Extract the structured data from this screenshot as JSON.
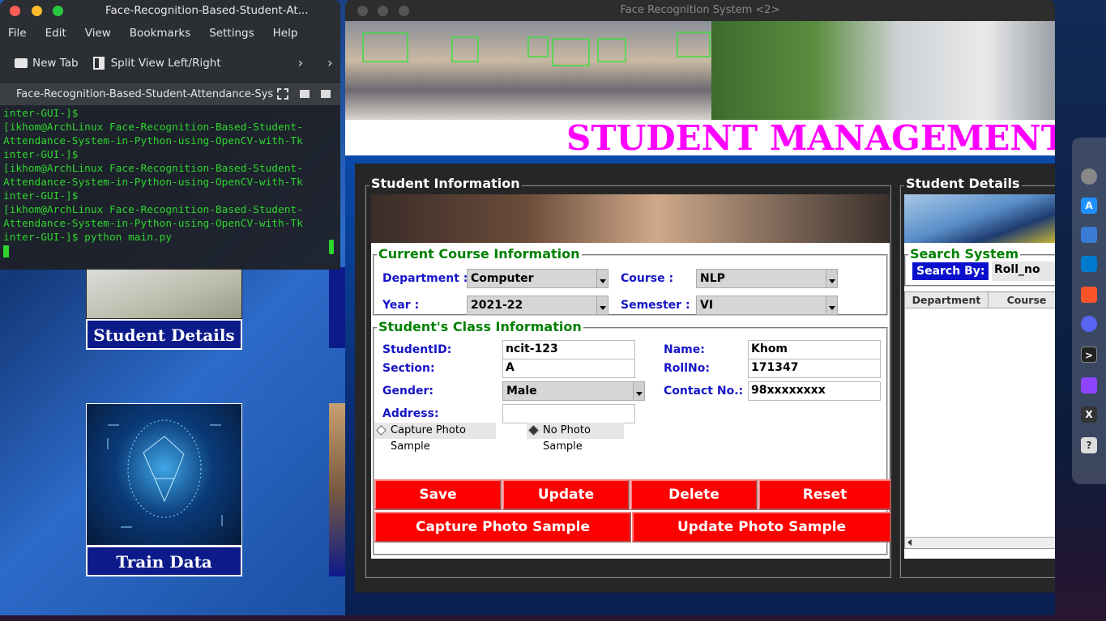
{
  "terminal": {
    "window_title": "Face-Recognition-Based-Student-At...",
    "menu": [
      "File",
      "Edit",
      "View",
      "Bookmarks",
      "Settings",
      "Help"
    ],
    "toolbar": {
      "new_tab": "New Tab",
      "split_view": "Split View Left/Right"
    },
    "tab_title": "Face-Recognition-Based-Student-Attendance-Systen",
    "lines": [
      "inter-GUI-]$",
      "[ikhom@ArchLinux Face-Recognition-Based-Student-",
      "Attendance-System-in-Python-using-OpenCV-with-Tk",
      "inter-GUI-]$",
      "[ikhom@ArchLinux Face-Recognition-Based-Student-",
      "Attendance-System-in-Python-using-OpenCV-with-Tk",
      "inter-GUI-]$",
      "[ikhom@ArchLinux Face-Recognition-Based-Student-",
      "Attendance-System-in-Python-using-OpenCV-with-Tk",
      "inter-GUI-]$ python main.py"
    ]
  },
  "background_app": {
    "tile_labels": {
      "student_details": "Student Details",
      "train_data": "Train Data"
    }
  },
  "main_window": {
    "window_title": "Face Recognition System <2>",
    "header_title": "STUDENT MANAGEMENT",
    "student_info": {
      "legend": "Student Information",
      "course": {
        "legend": "Current Course Information",
        "department_label": "Department :",
        "department_value": "Computer",
        "course_label": "Course :",
        "course_value": "NLP",
        "year_label": "Year :",
        "year_value": "2021-22",
        "semester_label": "Semester :",
        "semester_value": "VI"
      },
      "class": {
        "legend": "Student's Class Information",
        "studentid_label": "StudentID:",
        "studentid_value": "ncit-123",
        "name_label": "Name:",
        "name_value": "Khom",
        "section_label": "Section:",
        "section_value": "A",
        "rollno_label": "RollNo:",
        "rollno_value": "171347",
        "gender_label": "Gender:",
        "gender_value": "Male",
        "contact_label": "Contact No.:",
        "contact_value": "98xxxxxxxx",
        "address_label": "Address:",
        "address_value": "",
        "radio_capture": "Capture Photo Sample",
        "radio_no_photo": "No Photo Sample"
      },
      "buttons": {
        "save": "Save",
        "update": "Update",
        "delete": "Delete",
        "reset": "Reset",
        "capture": "Capture Photo Sample",
        "update_photo": "Update Photo Sample"
      }
    },
    "student_details": {
      "legend": "Student Details",
      "search_legend": "Search System",
      "search_by_label": "Search By:",
      "search_by_value": "Roll_no",
      "columns": [
        "Department",
        "Course"
      ]
    }
  },
  "colors": {
    "title_magenta": "#ff00ff",
    "button_red": "#ff0000",
    "label_blue": "#1515c8",
    "legend_green": "#008000",
    "terminal_green": "#2ed52e"
  }
}
